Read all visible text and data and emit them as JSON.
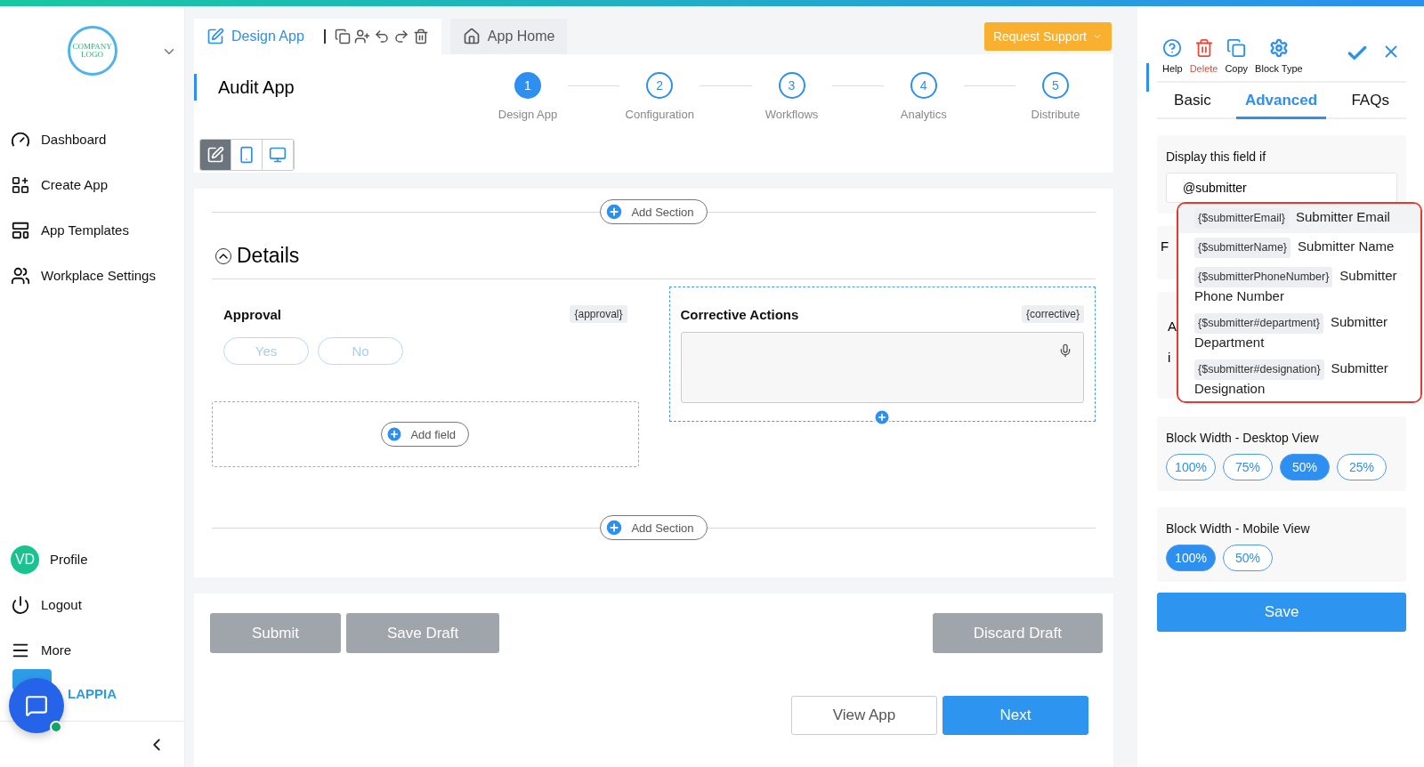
{
  "sidebar": {
    "logo_text": "COMPANY LOGO",
    "items": [
      {
        "label": "Dashboard",
        "kind": "dashboard"
      },
      {
        "label": "Create App",
        "kind": "create"
      },
      {
        "label": "App Templates",
        "kind": "templates"
      },
      {
        "label": "Workplace Settings",
        "kind": "workplace"
      }
    ],
    "profile": {
      "initials": "VD",
      "label": "Profile"
    },
    "bottom_items": [
      {
        "label": "Logout",
        "kind": "logout"
      },
      {
        "label": "More",
        "kind": "more"
      }
    ],
    "brand": "LAPPIA"
  },
  "top_tabs": [
    {
      "label": "Design App",
      "kind": "design",
      "selected": true
    },
    {
      "label": "App Home",
      "kind": "home",
      "selected": false
    }
  ],
  "request_support": "Request Support",
  "app_title": "Audit App",
  "steps": [
    {
      "number": "1",
      "label": "Design App",
      "selected": true
    },
    {
      "number": "2",
      "label": "Configuration",
      "selected": false
    },
    {
      "number": "3",
      "label": "Workflows",
      "selected": false
    },
    {
      "number": "4",
      "label": "Analytics",
      "selected": false
    },
    {
      "number": "5",
      "label": "Distribute",
      "selected": false
    }
  ],
  "view_modes": [
    {
      "kind": "edit",
      "selected": true
    },
    {
      "kind": "mobile",
      "selected": false
    },
    {
      "kind": "desktop",
      "selected": false
    }
  ],
  "form": {
    "add_section_top": "Add Section",
    "section_title": "Details",
    "expanded": true,
    "fields": [
      {
        "kind": "choice",
        "label": "Approval",
        "variable": "{approval}",
        "options": [
          "Yes",
          "No"
        ],
        "selected": false
      },
      {
        "kind": "text",
        "label": "Corrective Actions",
        "variable": "{corrective}",
        "selected": true
      }
    ],
    "add_field": "Add field",
    "add_section_bottom": "Add Section"
  },
  "form_buttons": [
    "Submit",
    "Save Draft",
    "Discard Draft"
  ],
  "nav_buttons": [
    {
      "label": "View App",
      "kind": "outline"
    },
    {
      "label": "Next",
      "kind": "primary"
    }
  ],
  "panel": {
    "actions": [
      {
        "label": "Help",
        "kind": "help"
      },
      {
        "label": "Delete",
        "kind": "delete"
      },
      {
        "label": "Copy",
        "kind": "copy"
      },
      {
        "label": "Block Type",
        "kind": "type"
      }
    ],
    "tabs": [
      {
        "label": "Basic",
        "selected": false
      },
      {
        "label": "Advanced",
        "selected": true
      },
      {
        "label": "FAQs",
        "selected": false
      }
    ],
    "condition": {
      "label": "Display this field if",
      "value": "@submitter"
    },
    "suggestions": [
      {
        "token": "{$submitterEmail}",
        "label": "Submitter Email",
        "selected": true
      },
      {
        "token": "{$submitterName}",
        "label": "Submitter Name",
        "selected": false
      },
      {
        "token": "{$submitterPhoneNumber}",
        "label": "Submitter Phone Number",
        "selected": false
      },
      {
        "token": "{$submitter#department}",
        "label": "Submitter Department",
        "selected": false
      },
      {
        "token": "{$submitter#designation}",
        "label": "Submitter Designation",
        "selected": false
      }
    ],
    "covered_labels": [
      "F",
      "A",
      "i"
    ],
    "width_groups": [
      {
        "label": "Block Width - Desktop View",
        "options": [
          {
            "label": "100%",
            "selected": false
          },
          {
            "label": "75%",
            "selected": false
          },
          {
            "label": "50%",
            "selected": true
          },
          {
            "label": "25%",
            "selected": false
          }
        ]
      },
      {
        "label": "Block Width - Mobile View",
        "options": [
          {
            "label": "100%",
            "selected": true
          },
          {
            "label": "50%",
            "selected": false
          }
        ]
      }
    ],
    "save": "Save"
  }
}
